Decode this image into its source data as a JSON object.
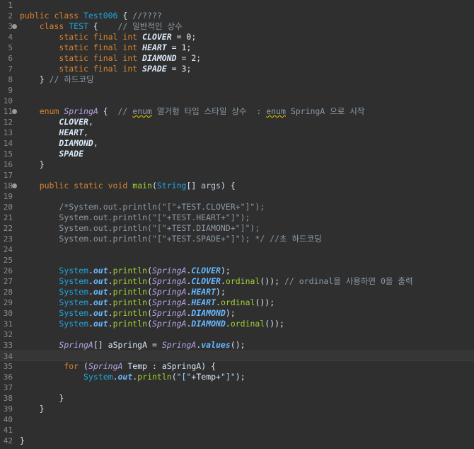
{
  "editor": {
    "lines": [
      {
        "n": "1",
        "fold": false,
        "tokens": []
      },
      {
        "n": "2",
        "fold": false,
        "tokens": [
          [
            "kw",
            "public "
          ],
          [
            "kw",
            "class "
          ],
          [
            "cls",
            "Test006"
          ],
          [
            "op",
            " { "
          ],
          [
            "cm",
            "//????"
          ]
        ]
      },
      {
        "n": "3",
        "fold": true,
        "tokens": [
          [
            "op",
            "    "
          ],
          [
            "kw",
            "class "
          ],
          [
            "cls",
            "TEST"
          ],
          [
            "op",
            " {    "
          ],
          [
            "cm",
            "// 일반적인 상수"
          ]
        ]
      },
      {
        "n": "4",
        "fold": false,
        "tokens": [
          [
            "op",
            "        "
          ],
          [
            "kw",
            "static final int "
          ],
          [
            "cnst",
            "CLOVER"
          ],
          [
            "op",
            " = "
          ],
          [
            "num",
            "0"
          ],
          [
            "op",
            ";"
          ]
        ]
      },
      {
        "n": "5",
        "fold": false,
        "tokens": [
          [
            "op",
            "        "
          ],
          [
            "kw",
            "static final int "
          ],
          [
            "cnst",
            "HEART"
          ],
          [
            "op",
            " = "
          ],
          [
            "num",
            "1"
          ],
          [
            "op",
            ";"
          ]
        ]
      },
      {
        "n": "6",
        "fold": false,
        "tokens": [
          [
            "op",
            "        "
          ],
          [
            "kw",
            "static final int "
          ],
          [
            "cnst",
            "DIAMOND"
          ],
          [
            "op",
            " = "
          ],
          [
            "num",
            "2"
          ],
          [
            "op",
            ";"
          ]
        ]
      },
      {
        "n": "7",
        "fold": false,
        "tokens": [
          [
            "op",
            "        "
          ],
          [
            "kw",
            "static final int "
          ],
          [
            "cnst",
            "SPADE"
          ],
          [
            "op",
            " = "
          ],
          [
            "num",
            "3"
          ],
          [
            "op",
            ";"
          ]
        ]
      },
      {
        "n": "8",
        "fold": false,
        "tokens": [
          [
            "op",
            "    } "
          ],
          [
            "cm",
            "// 하드코딩"
          ]
        ]
      },
      {
        "n": "9",
        "fold": false,
        "tokens": []
      },
      {
        "n": "10",
        "fold": false,
        "tokens": []
      },
      {
        "n": "11",
        "fold": true,
        "tokens": [
          [
            "op",
            "    "
          ],
          [
            "kw",
            "enum "
          ],
          [
            "enm",
            "SpringA"
          ],
          [
            "op",
            " {  "
          ],
          [
            "cm",
            "// "
          ],
          [
            "cmu",
            "enum"
          ],
          [
            "cm",
            " 열거형 타입 스타일 상수  : "
          ],
          [
            "cmu",
            "enum"
          ],
          [
            "cm",
            " SpringA 으로 시작"
          ]
        ]
      },
      {
        "n": "12",
        "fold": false,
        "tokens": [
          [
            "op",
            "        "
          ],
          [
            "enmf",
            "CLOVER"
          ],
          [
            "op",
            ","
          ]
        ]
      },
      {
        "n": "13",
        "fold": false,
        "tokens": [
          [
            "op",
            "        "
          ],
          [
            "enmf",
            "HEART"
          ],
          [
            "op",
            ","
          ]
        ]
      },
      {
        "n": "14",
        "fold": false,
        "tokens": [
          [
            "op",
            "        "
          ],
          [
            "enmf",
            "DIAMOND"
          ],
          [
            "op",
            ","
          ]
        ]
      },
      {
        "n": "15",
        "fold": false,
        "tokens": [
          [
            "op",
            "        "
          ],
          [
            "enmf",
            "SPADE"
          ]
        ]
      },
      {
        "n": "16",
        "fold": false,
        "tokens": [
          [
            "op",
            "    }"
          ]
        ]
      },
      {
        "n": "17",
        "fold": false,
        "tokens": []
      },
      {
        "n": "18",
        "fold": true,
        "tokens": [
          [
            "op",
            "    "
          ],
          [
            "kw",
            "public static void "
          ],
          [
            "fn",
            "main"
          ],
          [
            "op",
            "("
          ],
          [
            "cls",
            "String"
          ],
          [
            "op",
            "[] "
          ],
          [
            "param",
            "args"
          ],
          [
            "op",
            ") {"
          ]
        ]
      },
      {
        "n": "19",
        "fold": false,
        "tokens": []
      },
      {
        "n": "20",
        "fold": false,
        "tokens": [
          [
            "op",
            "        "
          ],
          [
            "cm",
            "/*System.out.println(\"[\"+TEST.CLOVER+\"]\");"
          ]
        ]
      },
      {
        "n": "21",
        "fold": false,
        "tokens": [
          [
            "op",
            "        "
          ],
          [
            "cm",
            "System.out.println(\"[\"+TEST.HEART+\"]\");"
          ]
        ]
      },
      {
        "n": "22",
        "fold": false,
        "tokens": [
          [
            "op",
            "        "
          ],
          [
            "cm",
            "System.out.println(\"[\"+TEST.DIAMOND+\"]\");"
          ]
        ]
      },
      {
        "n": "23",
        "fold": false,
        "tokens": [
          [
            "op",
            "        "
          ],
          [
            "cm",
            "System.out.println(\"[\"+TEST.SPADE+\"]\"); */ //초 하드코딩"
          ]
        ]
      },
      {
        "n": "24",
        "fold": false,
        "tokens": []
      },
      {
        "n": "25",
        "fold": false,
        "tokens": []
      },
      {
        "n": "26",
        "fold": false,
        "tokens": [
          [
            "op",
            "        "
          ],
          [
            "cls",
            "System"
          ],
          [
            "op",
            "."
          ],
          [
            "fld",
            "out"
          ],
          [
            "op",
            "."
          ],
          [
            "met",
            "println"
          ],
          [
            "op",
            "("
          ],
          [
            "enm",
            "SpringA"
          ],
          [
            "op",
            "."
          ],
          [
            "fld",
            "CLOVER"
          ],
          [
            "op",
            ");"
          ]
        ]
      },
      {
        "n": "27",
        "fold": false,
        "tokens": [
          [
            "op",
            "        "
          ],
          [
            "cls",
            "System"
          ],
          [
            "op",
            "."
          ],
          [
            "fld",
            "out"
          ],
          [
            "op",
            "."
          ],
          [
            "met",
            "println"
          ],
          [
            "op",
            "("
          ],
          [
            "enm",
            "SpringA"
          ],
          [
            "op",
            "."
          ],
          [
            "fld",
            "CLOVER"
          ],
          [
            "op",
            "."
          ],
          [
            "met",
            "ordinal"
          ],
          [
            "op",
            "()); "
          ],
          [
            "cm",
            "// ordinal을 사용하면 0을 출력"
          ]
        ]
      },
      {
        "n": "28",
        "fold": false,
        "tokens": [
          [
            "op",
            "        "
          ],
          [
            "cls",
            "System"
          ],
          [
            "op",
            "."
          ],
          [
            "fld",
            "out"
          ],
          [
            "op",
            "."
          ],
          [
            "met",
            "println"
          ],
          [
            "op",
            "("
          ],
          [
            "enm",
            "SpringA"
          ],
          [
            "op",
            "."
          ],
          [
            "fld",
            "HEART"
          ],
          [
            "op",
            ");"
          ]
        ]
      },
      {
        "n": "29",
        "fold": false,
        "tokens": [
          [
            "op",
            "        "
          ],
          [
            "cls",
            "System"
          ],
          [
            "op",
            "."
          ],
          [
            "fld",
            "out"
          ],
          [
            "op",
            "."
          ],
          [
            "met",
            "println"
          ],
          [
            "op",
            "("
          ],
          [
            "enm",
            "SpringA"
          ],
          [
            "op",
            "."
          ],
          [
            "fld",
            "HEART"
          ],
          [
            "op",
            "."
          ],
          [
            "met",
            "ordinal"
          ],
          [
            "op",
            "());"
          ]
        ]
      },
      {
        "n": "30",
        "fold": false,
        "tokens": [
          [
            "op",
            "        "
          ],
          [
            "cls",
            "System"
          ],
          [
            "op",
            "."
          ],
          [
            "fld",
            "out"
          ],
          [
            "op",
            "."
          ],
          [
            "met",
            "println"
          ],
          [
            "op",
            "("
          ],
          [
            "enm",
            "SpringA"
          ],
          [
            "op",
            "."
          ],
          [
            "fld",
            "DIAMOND"
          ],
          [
            "op",
            ");"
          ]
        ]
      },
      {
        "n": "31",
        "fold": false,
        "tokens": [
          [
            "op",
            "        "
          ],
          [
            "cls",
            "System"
          ],
          [
            "op",
            "."
          ],
          [
            "fld",
            "out"
          ],
          [
            "op",
            "."
          ],
          [
            "met",
            "println"
          ],
          [
            "op",
            "("
          ],
          [
            "enm",
            "SpringA"
          ],
          [
            "op",
            "."
          ],
          [
            "fld",
            "DIAMOND"
          ],
          [
            "op",
            "."
          ],
          [
            "met",
            "ordinal"
          ],
          [
            "op",
            "());"
          ]
        ]
      },
      {
        "n": "32",
        "fold": false,
        "tokens": []
      },
      {
        "n": "33",
        "fold": false,
        "tokens": [
          [
            "op",
            "        "
          ],
          [
            "enm",
            "SpringA"
          ],
          [
            "op",
            "[] "
          ],
          [
            "var",
            "aSpringA"
          ],
          [
            "op",
            " = "
          ],
          [
            "enm",
            "SpringA"
          ],
          [
            "op",
            "."
          ],
          [
            "fld",
            "values"
          ],
          [
            "op",
            "();"
          ]
        ]
      },
      {
        "n": "34",
        "fold": false,
        "current": true,
        "tokens": []
      },
      {
        "n": "35",
        "fold": false,
        "tokens": [
          [
            "op",
            "         "
          ],
          [
            "kw",
            "for "
          ],
          [
            "op",
            "("
          ],
          [
            "enm",
            "SpringA"
          ],
          [
            "op",
            " "
          ],
          [
            "var",
            "Temp"
          ],
          [
            "op",
            " : "
          ],
          [
            "var",
            "aSpringA"
          ],
          [
            "op",
            ") {"
          ]
        ]
      },
      {
        "n": "36",
        "fold": false,
        "tokens": [
          [
            "op",
            "             "
          ],
          [
            "cls",
            "System"
          ],
          [
            "op",
            "."
          ],
          [
            "fld",
            "out"
          ],
          [
            "op",
            "."
          ],
          [
            "met",
            "println"
          ],
          [
            "op",
            "("
          ],
          [
            "str",
            "\"[\""
          ],
          [
            "op",
            "+"
          ],
          [
            "var",
            "Temp"
          ],
          [
            "op",
            "+"
          ],
          [
            "str",
            "\"]\""
          ],
          [
            "op",
            ");"
          ]
        ]
      },
      {
        "n": "37",
        "fold": false,
        "tokens": []
      },
      {
        "n": "38",
        "fold": false,
        "tokens": [
          [
            "op",
            "        }"
          ]
        ]
      },
      {
        "n": "39",
        "fold": false,
        "tokens": [
          [
            "op",
            "    }"
          ]
        ]
      },
      {
        "n": "40",
        "fold": false,
        "tokens": []
      },
      {
        "n": "41",
        "fold": false,
        "tokens": []
      },
      {
        "n": "42",
        "fold": false,
        "tokens": [
          [
            "op",
            "}"
          ]
        ]
      }
    ]
  }
}
